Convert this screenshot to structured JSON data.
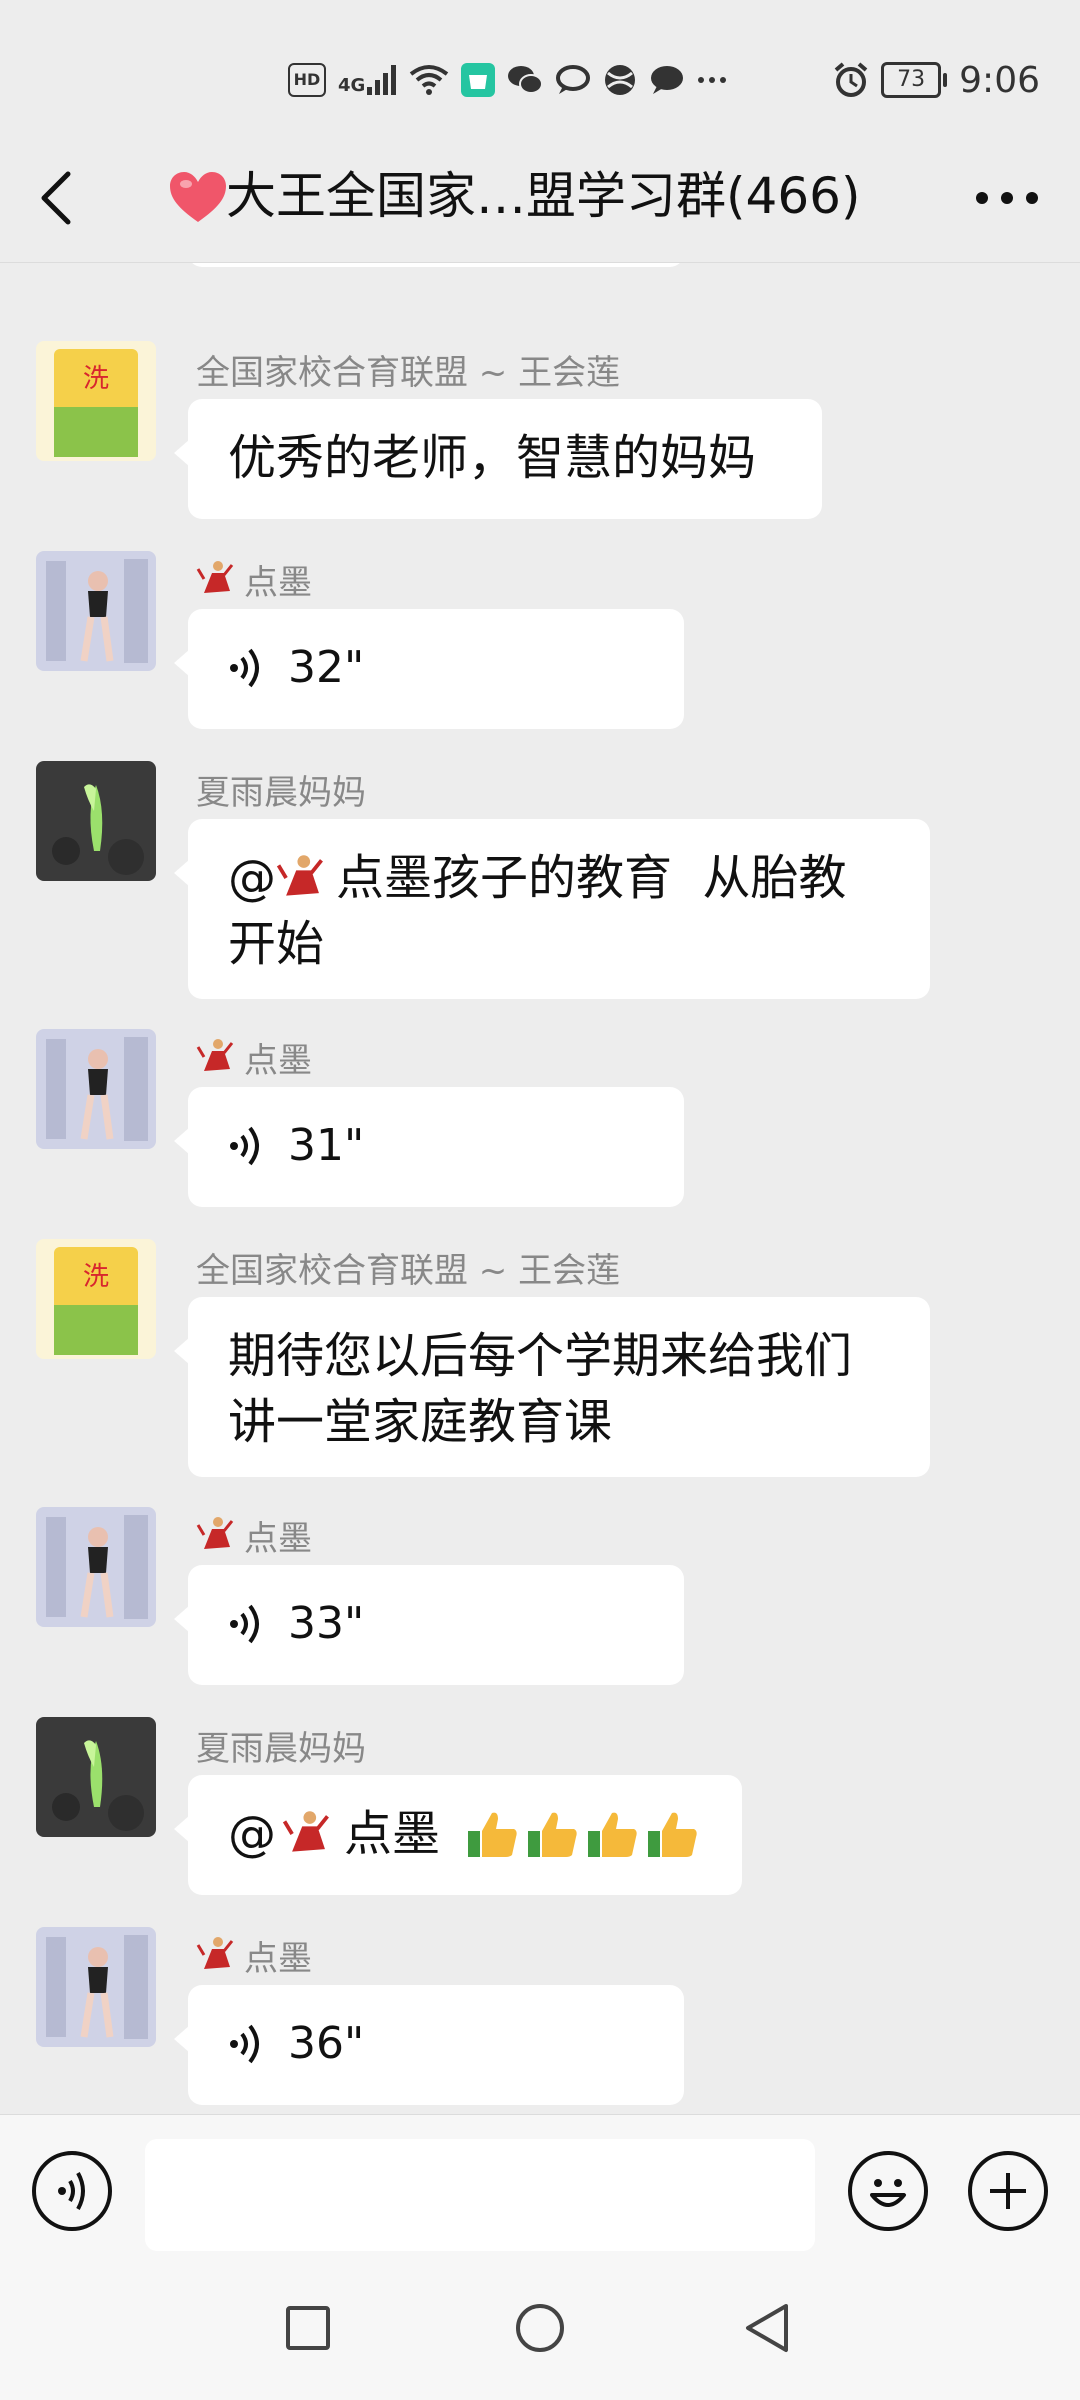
{
  "status_bar": {
    "hd": "HD",
    "network": "4G",
    "battery": "73",
    "time": "9:06"
  },
  "header": {
    "title": "大王全国家…盟学习群(466)",
    "back_icon": "chevron-left-icon",
    "more_icon": "more-horizontal-icon"
  },
  "messages": [
    {
      "sender": "全国家校合育联盟 ~ 王会莲",
      "type": "text",
      "text": "优秀的老师，智慧的妈妈"
    },
    {
      "sender": "点墨",
      "type": "voice",
      "duration": "32\""
    },
    {
      "sender": "夏雨晨妈妈",
      "type": "text",
      "line1": "@",
      "mention": "点墨孩子的教育  从胎教",
      "line2": "开始"
    },
    {
      "sender": "点墨",
      "type": "voice",
      "duration": "31\""
    },
    {
      "sender": "全国家校合育联盟 ~ 王会莲",
      "type": "text",
      "line1": "期待您以后每个学期来给我们",
      "line2": "讲一堂家庭教育课"
    },
    {
      "sender": "点墨",
      "type": "voice",
      "duration": "33\""
    },
    {
      "sender": "夏雨晨妈妈",
      "type": "text",
      "line1": "@",
      "mention": "点墨"
    },
    {
      "sender": "点墨",
      "type": "voice",
      "duration": "36\""
    }
  ],
  "input_bar": {
    "voice_icon": "voice-input-icon",
    "emoji_icon": "emoji-icon",
    "add_icon": "plus-icon",
    "placeholder": ""
  },
  "colors": {
    "background": "#ededed",
    "bubble": "#ffffff",
    "sender": "#888888",
    "heart": "#f0566a",
    "thumb": "#f5b93a"
  }
}
